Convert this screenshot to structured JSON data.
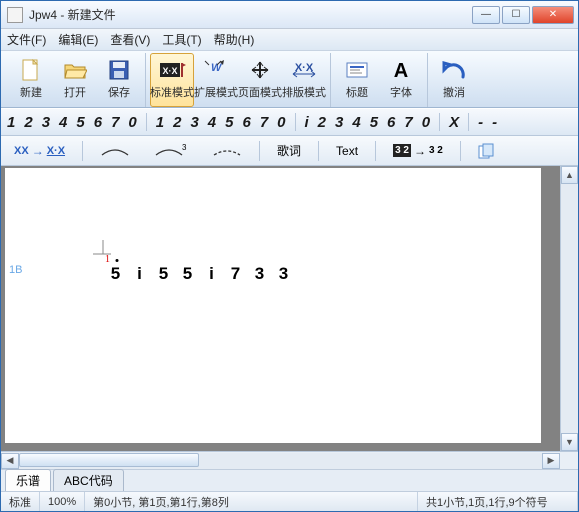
{
  "window": {
    "title": "Jpw4 - 新建文件"
  },
  "window_buttons": {
    "min": "—",
    "max": "☐",
    "close": "✕"
  },
  "menu": {
    "file": "文件(F)",
    "edit": "编辑(E)",
    "view": "查看(V)",
    "tools": "工具(T)",
    "help": "帮助(H)"
  },
  "toolbar": {
    "new": "新建",
    "open": "打开",
    "save": "保存",
    "std_mode": "标准模式",
    "ext_mode": "扩展模式",
    "page_mode": "页面模式",
    "layout_mode": "排版模式",
    "title_btn": "标题",
    "font": "字体",
    "undo": "撤消"
  },
  "numrow": {
    "set1": [
      "1",
      "2",
      "3",
      "4",
      "5",
      "6",
      "7",
      "0"
    ],
    "set2": [
      "1",
      "2",
      "3",
      "4",
      "5",
      "6",
      "7",
      "0"
    ],
    "set_i": [
      "i",
      "2",
      "3",
      "4",
      "5",
      "6",
      "7",
      "0"
    ],
    "x": "X",
    "dashes": [
      "-",
      "-"
    ]
  },
  "aux": {
    "xx_glyph": "XX",
    "dotxx_glyph": "X·X",
    "lyrics": "歌词",
    "text": "Text",
    "frac_from": "3 2",
    "frac_to": "3 2"
  },
  "canvas": {
    "red_mark": "1",
    "blue_mark": "1B",
    "notes": [
      {
        "v": "5",
        "dot": true
      },
      {
        "v": "i",
        "dot": false
      },
      {
        "v": "5",
        "dot": false
      },
      {
        "v": "5",
        "dot": false
      },
      {
        "v": "i",
        "dot": false
      },
      {
        "v": "7",
        "dot": false
      },
      {
        "v": "3",
        "dot": false
      },
      {
        "v": "3",
        "dot": false
      }
    ]
  },
  "tabs": {
    "score": "乐谱",
    "abc": "ABC代码"
  },
  "status": {
    "mode": "标准",
    "zoom": "100%",
    "pos": "第0小节, 第1页,第1行,第8列",
    "summary": "共1小节,1页,1行,9个符号"
  }
}
